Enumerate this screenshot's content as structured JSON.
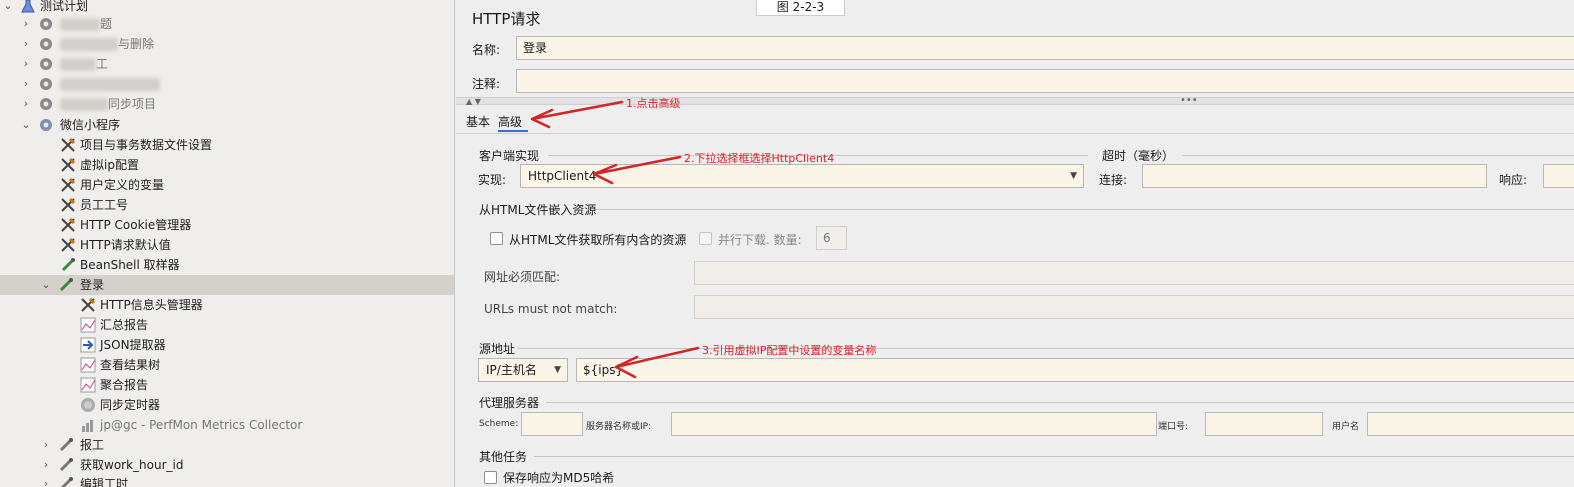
{
  "figure_label": "图 2-2-3",
  "tree": {
    "root": "测试计划",
    "group_items": [
      "题",
      "与删除",
      "工",
      "",
      "同步项目"
    ],
    "expanded_group": "微信小程序",
    "items": [
      "项目与事务数据文件设置",
      "虚拟ip配置",
      "用户定义的变量",
      "员工工号",
      "HTTP Cookie管理器",
      "HTTP请求默认值",
      "BeanShell 取样器"
    ],
    "selected": "登录",
    "children": [
      "HTTP信息头管理器",
      "汇总报告",
      "JSON提取器",
      "查看结果树",
      "聚合报告",
      "同步定时器",
      "jp@gc - PerfMon Metrics Collector"
    ],
    "after": [
      "报工",
      "获取work_hour_id",
      "编辑工时"
    ]
  },
  "panel": {
    "title": "HTTP请求",
    "name_label": "名称:",
    "name_value": "登录",
    "comment_label": "注释:",
    "comment_value": "",
    "tabs": [
      "基本",
      "高级"
    ],
    "client_impl_group": "客户端实现",
    "impl_label": "实现:",
    "impl_value": "HttpClient4",
    "timeout_group": "超时（毫秒）",
    "connect_label": "连接:",
    "response_label": "响应:",
    "embedded_group": "从HTML文件嵌入资源",
    "fetch_all_label": "从HTML文件获取所有内含的资源",
    "parallel_label": "并行下载. 数量:",
    "parallel_value": "6",
    "url_match_label": "网址必须匹配:",
    "url_not_match_label": "URLs must not match:",
    "source_group": "源地址",
    "source_type": "IP/主机名",
    "source_value": "${ips}",
    "proxy_group": "代理服务器",
    "scheme_label": "Scheme:",
    "server_label": "服务器名称或IP:",
    "port_label": "端口号:",
    "user_label": "用户名",
    "other_group": "其他任务",
    "md5_label": "保存响应为MD5哈希"
  },
  "annotations": {
    "a1": "1.点击高级",
    "a2": "2.下拉选择框选择HttpClient4",
    "a3": "3.引用虚拟IP配置中设置的变量名称"
  },
  "colors": {
    "annotation": "#d3242a",
    "field_bg": "#fbf5e8",
    "selected_row": "#d6d0cb"
  }
}
